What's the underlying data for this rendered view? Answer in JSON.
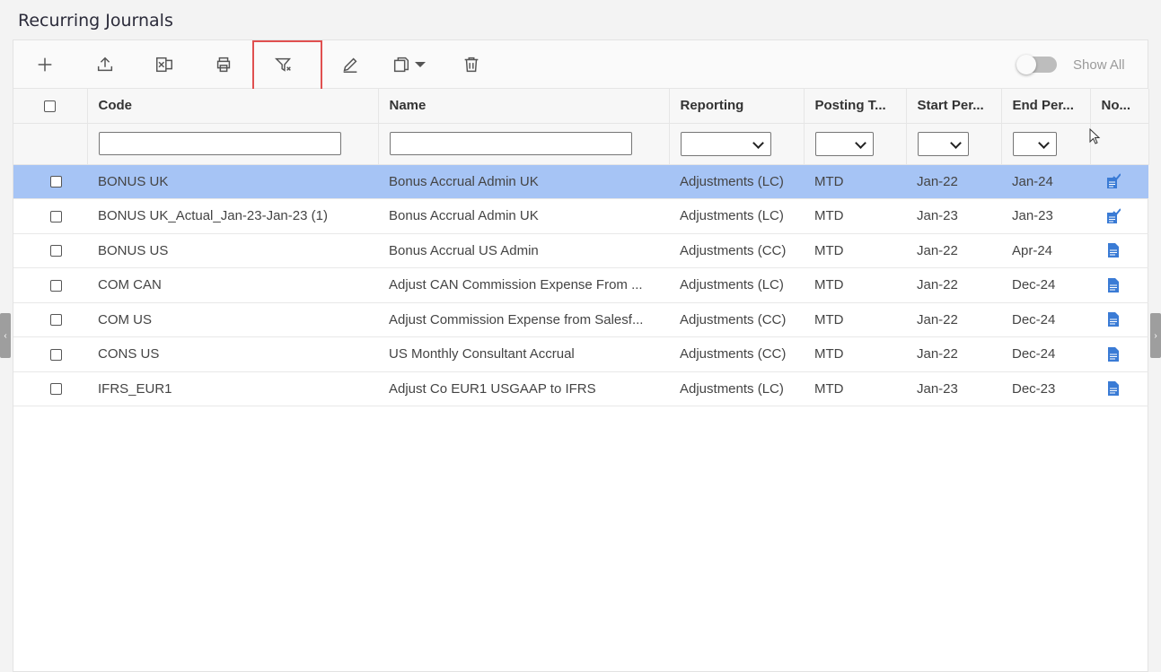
{
  "page_title": "Recurring Journals",
  "toolbar": {
    "icons": [
      "add-icon",
      "upload-icon",
      "excel-export-icon",
      "print-icon",
      "clear-filter-icon",
      "edit-icon",
      "copy-dropdown-icon",
      "delete-icon"
    ],
    "show_all_label": "Show All",
    "show_all_on": false
  },
  "columns": [
    "Code",
    "Name",
    "Reporting",
    "Posting T...",
    "Start Per...",
    "End Per...",
    "No..."
  ],
  "rows": [
    {
      "code": "BONUS UK",
      "name": "Bonus Accrual Admin UK",
      "reporting": "Adjustments (LC)",
      "posting": "MTD",
      "start": "Jan-22",
      "end": "Jan-24",
      "note_icon": "note-checked-icon",
      "selected": true
    },
    {
      "code": "BONUS UK_Actual_Jan-23-Jan-23 (1)",
      "name": "Bonus Accrual Admin UK",
      "reporting": "Adjustments (LC)",
      "posting": "MTD",
      "start": "Jan-23",
      "end": "Jan-23",
      "note_icon": "note-checked-icon",
      "selected": false
    },
    {
      "code": "BONUS US",
      "name": "Bonus Accrual US Admin",
      "reporting": "Adjustments (CC)",
      "posting": "MTD",
      "start": "Jan-22",
      "end": "Apr-24",
      "note_icon": "document-icon",
      "selected": false
    },
    {
      "code": "COM CAN",
      "name": "Adjust CAN Commission Expense From ...",
      "reporting": "Adjustments (LC)",
      "posting": "MTD",
      "start": "Jan-22",
      "end": "Dec-24",
      "note_icon": "document-icon",
      "selected": false
    },
    {
      "code": "COM US",
      "name": "Adjust Commission Expense from Salesf...",
      "reporting": "Adjustments (CC)",
      "posting": "MTD",
      "start": "Jan-22",
      "end": "Dec-24",
      "note_icon": "document-icon",
      "selected": false
    },
    {
      "code": "CONS US",
      "name": "US Monthly Consultant Accrual",
      "reporting": "Adjustments (CC)",
      "posting": "MTD",
      "start": "Jan-22",
      "end": "Dec-24",
      "note_icon": "document-icon",
      "selected": false
    },
    {
      "code": "IFRS_EUR1",
      "name": "Adjust Co EUR1 USGAAP to IFRS",
      "reporting": "Adjustments (LC)",
      "posting": "MTD",
      "start": "Jan-23",
      "end": "Dec-23",
      "note_icon": "document-icon",
      "selected": false
    }
  ],
  "colors": {
    "selected_row": "#a6c4f5",
    "highlight_box": "#e05050",
    "doc_icon": "#3a7bd5"
  }
}
